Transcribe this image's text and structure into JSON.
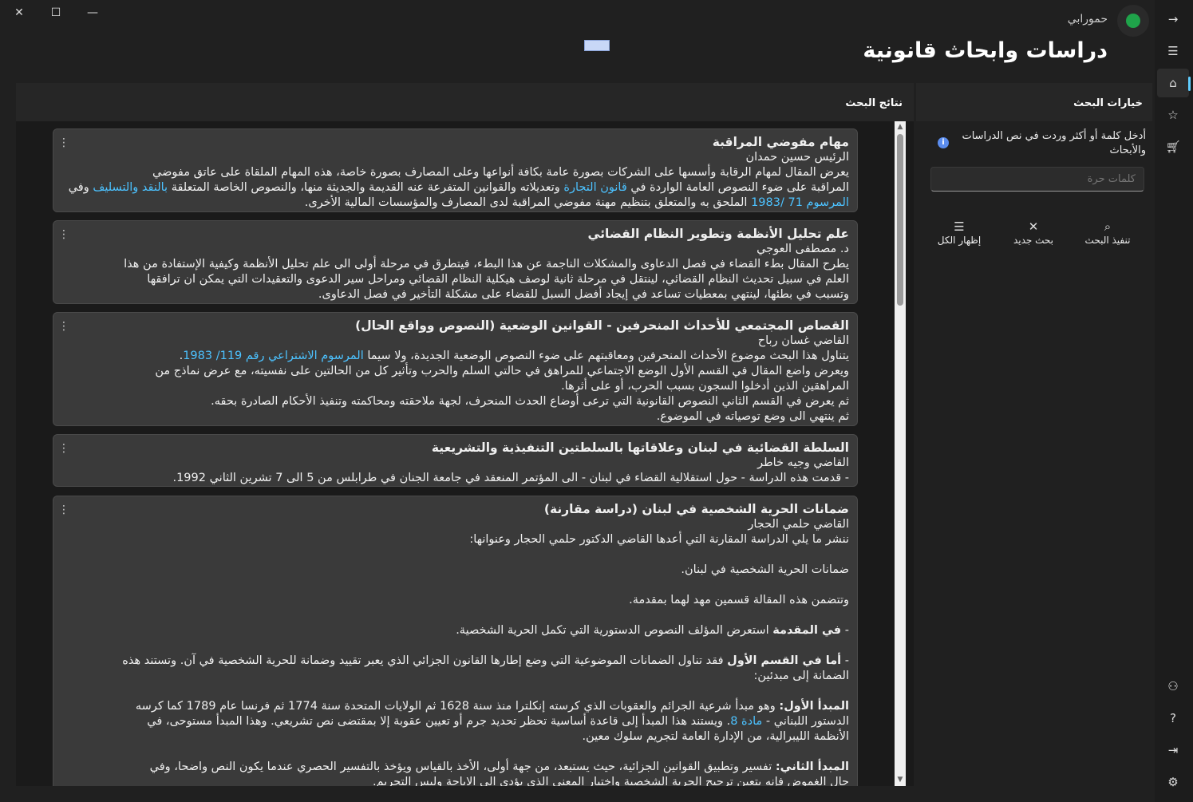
{
  "window": {
    "close_icon": "close-icon",
    "maximize_icon": "maximize-icon",
    "minimize_icon": "minimize-icon"
  },
  "user": {
    "name": "حمورابي"
  },
  "page": {
    "title": "دراسات وابحاث قانونية"
  },
  "results_panel": {
    "header": "نتائج البحث"
  },
  "options_panel": {
    "header": "خيارات البحث",
    "info_text": "أدخل كلمة أو أكثر وردت في نص الدراسات والأبحاث",
    "keywords_placeholder": "كلمات حرة",
    "buttons": {
      "search": "تنفيذ البحث",
      "new": "بحث جديد",
      "show_all": "إظهار الكل"
    }
  },
  "sidebar": {
    "icons": [
      "arrow-right-icon",
      "menu-icon",
      "home-icon",
      "star-icon",
      "cart-icon",
      "users-icon",
      "help-icon",
      "logout-icon",
      "settings-icon"
    ]
  },
  "results": [
    {
      "title": "مهام مفوضي المراقبة",
      "author": "الرئيس حسين حمدان",
      "lines": [
        "يعرض المقال لمهام الرقابة وأسسها على الشركات بصورة عامة بكافة أنواعها وعلى المصارف بصورة خاصة، هذه المهام الملقاة على عاتق مفوضي",
        "المراقبة على ضوء النصوص العامة الواردة في",
        "وتعديلاته والقوانين المتفرعة عنه القديمة والجديثة منها، والنصوص الخاصة المتعلقة",
        "وفي",
        "الملحق به والمتعلق بتنظيم مهنة مفوضي المراقبة لدى المصارف والمؤسسات المالية الأخرى."
      ],
      "links": [
        "قانون التجارة",
        "بالنقد والتسليف",
        "المرسوم 71 /1983"
      ]
    },
    {
      "title": "علم تحليل الأنظمة وتطوير النظام القضائي",
      "author": "د. مصطفى العوجي",
      "lines": [
        "يطرح المقال بطء القضاء في فصل الدعاوى والمشكلات الناجمة عن هذا البطء، فيتطرق في مرحلة أولى الى علم تحليل الأنظمة وكيفية الإستفادة من هذا",
        "العلم في سبيل تحديث النظام القضائي، لينتقل في مرحلة ثانية لوصف هيكلية النظام القضائي ومراحل سير الدعوى والتعقيدات التي يمكن ان ترافقها",
        "وتسبب في بطئها، لينتهي بمعطيات تساعد في إيجاد أفضل السبل للقضاء على مشكلة التأخير في فصل الدعاوى."
      ]
    },
    {
      "title": "القصاص المجتمعي للأحداث المنحرفين - القوانين الوضعية (النصوص وواقع الحال)",
      "author": "القاضي غسان رباح",
      "lines": [
        "يتناول هذا البحث موضوع الأحداث المنحرفين ومعاقبتهم على ضوء النصوص الوضعية الجديدة، ولا سيما",
        "ويعرض واضع المقال في القسم الأول الوضع الاجتماعي للمراهق في حالتي السلم والحرب وتأثير كل من الحالتين على نفسيته، مع عرض نماذج من",
        "المراهقين الذين أدخلوا السجون بسبب الحرب، أو على أثرها.",
        "ثم يعرض في القسم الثاني النصوص القانونية التي ترعى أوضاع الحدث المنحرف، لجهة ملاحقته ومحاكمته وتنفيذ الأحكام الصادرة بحقه.",
        "ثم ينتهي الى وضع توصياته في الموضوع."
      ],
      "links": [
        "المرسوم الاشتراعي رقم 119/ 1983"
      ]
    },
    {
      "title": "السلطة القضائية في لبنان وعلاقاتها بالسلطتين التنفيذية والتشريعية",
      "author": "القاضي وجيه خاطر",
      "lines": [
        "- قدمت هذه الدراسة - حول استقلالية القضاء في لبنان - الى المؤتمر المنعقد في جامعة الجنان في طرابلس من 5 الى 7 تشرين الثاني 1992."
      ]
    },
    {
      "title": "ضمانات الحرية الشخصية في لبنان (دراسة مقارنة)",
      "author": "القاضي حلمي الحجار",
      "lines": [
        "ننشر ما يلي الدراسة المقارنة التي أعدها القاضي الدكتور حلمي الحجار وعنوانها:",
        "ضمانات الحرية الشخصية في لبنان.",
        "وتتضمن هذه المقالة قسمين مهد لهما بمقدمة.",
        "- ",
        "في المقدمة",
        " استعرض المؤلف النصوص الدستورية التي تكمل الحرية الشخصية.",
        "أما في القسم الأول",
        " فقد تناول الضمانات الموضوعية التي وضع إطارها القانون الجزائي الذي يعبر تقييد وضمانة للحرية الشخصية في آن. وتستند هذه",
        "الضمانة إلى مبدئين:",
        "المبدأ الأول:",
        " وهو مبدأ شرعية الجرائم والعقوبات الذي كرسته إنكلترا منذ سنة 1628 ثم الولايات المتحدة سنة 1774 ثم فرنسا عام 1789 كما كرسه",
        "الدستور اللبناني -",
        "مادة 8",
        ". ويستند هذا المبدأ إلى قاعدة أساسية تحظر تحديد جرم أو تعيين عقوبة إلا بمقتضى نص تشريعي. وهذا المبدأ مستوحى، في",
        "الأنظمة الليبرالية، من الإدارة العامة لتجريم سلوك معين.",
        "المبدأ الثاني:",
        " تفسير وتطبيق القوانين الجزائية، حيث يستبعد، من جهة أولى، الأخذ بالقياس ويؤخذ بالتفسير الحصري عندما يكون النص واضحا، وفي",
        "حال الغموض فإنه يتعين ترجيح الحرية الشخصية واختيار المعنى الذي يؤدي الى الاباحة وليس التجريم."
      ]
    }
  ]
}
